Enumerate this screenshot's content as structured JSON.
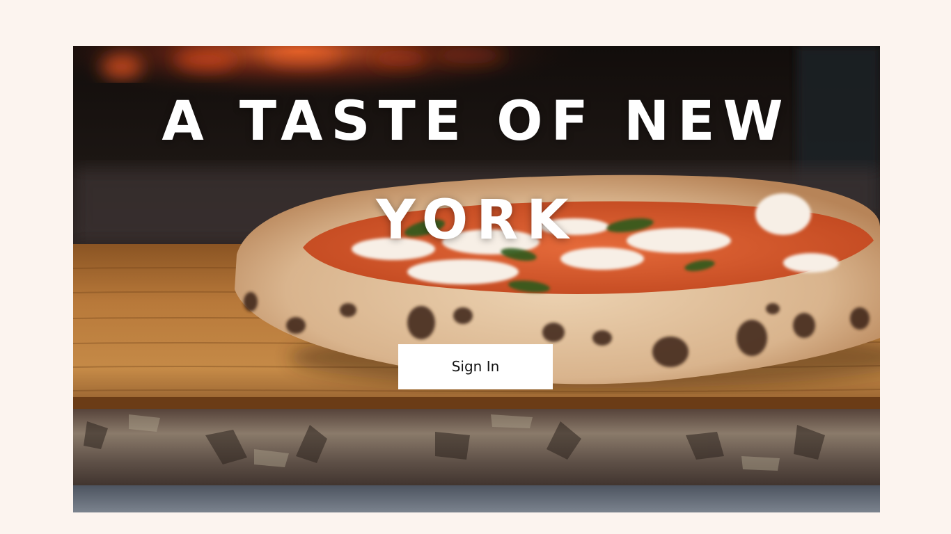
{
  "hero": {
    "title": "A TASTE OF NEW YORK",
    "image_alt": "Neapolitan pizza on a wooden board in front of an oven"
  },
  "actions": {
    "sign_in_label": "Sign In"
  },
  "colors": {
    "page_background": "#fcf4ef",
    "button_background": "#ffffff",
    "title_text": "#ffffff"
  }
}
